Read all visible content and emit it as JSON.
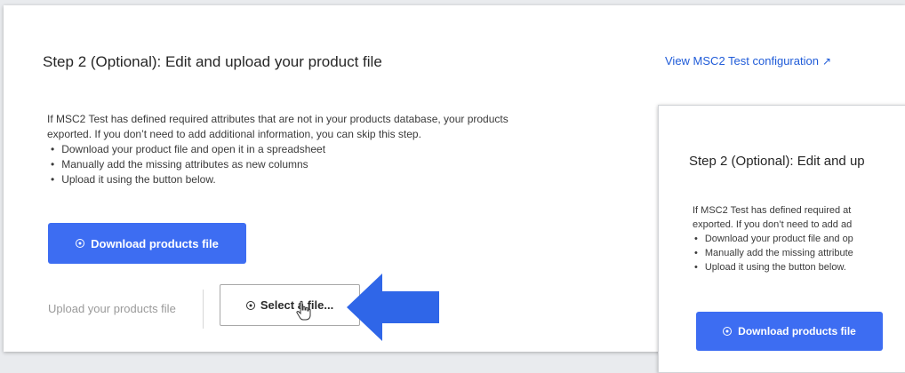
{
  "main": {
    "title": "Step 2 (Optional): Edit and upload your product file",
    "config_link": "View MSC2 Test configuration",
    "paragraph_line1": "If MSC2 Test has defined required attributes that are not in your products database, your products",
    "paragraph_line2": "exported. If you don’t need to add additional information, you can skip this step.",
    "bullets": [
      "Download your product file and open it in a spreadsheet",
      "Manually add the missing attributes as new columns",
      "Upload it using the button below."
    ],
    "download_button": "Download products file",
    "upload_label": "Upload your products file",
    "select_button": "Select a file..."
  },
  "zoom": {
    "title": "Step 2 (Optional): Edit and up",
    "paragraph_line1": "If MSC2 Test has defined required at",
    "paragraph_line2": "exported. If you don’t need to add ad",
    "bullets": [
      "Download your product file and op",
      "Manually add the missing attribute",
      "Upload it using the button below."
    ],
    "download_button": "Download products file"
  },
  "icons": {
    "external_link": "external-link-icon",
    "download": "circle-icon",
    "select": "circle-icon",
    "cursor": "hand-cursor-icon",
    "pointer": "left-arrow-icon"
  },
  "colors": {
    "primary": "#3d6df2",
    "arrow": "#2f66e8",
    "link": "#1f5bd8"
  }
}
